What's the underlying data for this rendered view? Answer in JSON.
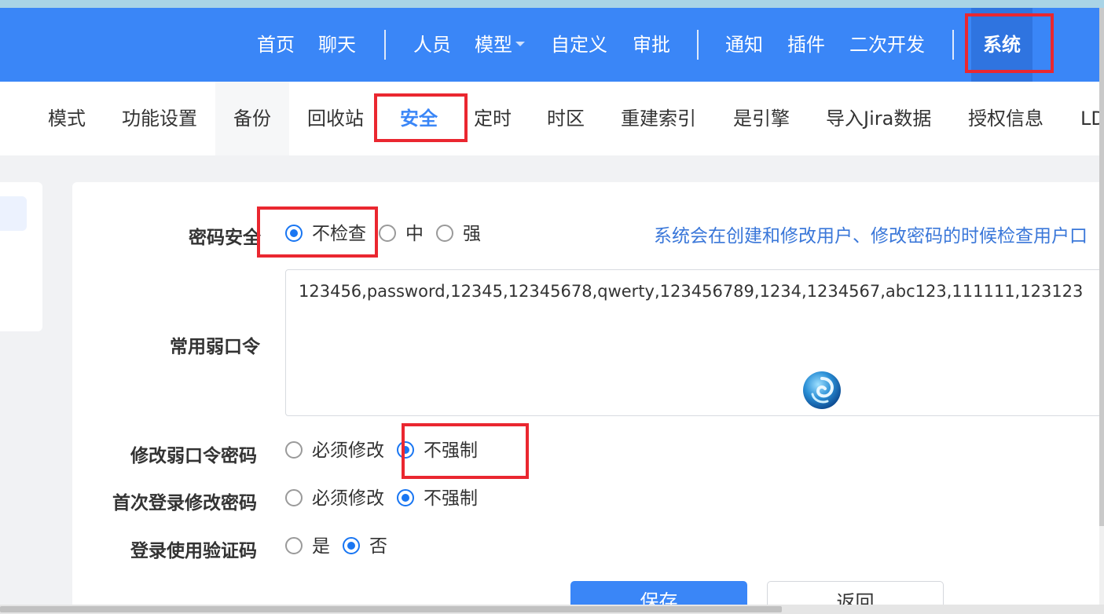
{
  "top_nav": {
    "items": [
      "首页",
      "聊天",
      "人员",
      "模型",
      "自定义",
      "审批",
      "通知",
      "插件",
      "二次开发",
      "系统"
    ],
    "active": "系统"
  },
  "sub_nav": {
    "tabs": [
      "模式",
      "功能设置",
      "备份",
      "回收站",
      "安全",
      "定时",
      "时区",
      "重建索引",
      "是引擎",
      "导入Jira数据",
      "授权信息",
      "LD"
    ],
    "active": "安全"
  },
  "form": {
    "password_security": {
      "label": "密码安全",
      "options": [
        "不检查",
        "中",
        "强"
      ],
      "selected": "不检查",
      "hint": "系统会在创建和修改用户、修改密码的时候检查用户口"
    },
    "weak_passwords": {
      "label": "常用弱口令",
      "value": "123456,password,12345,12345678,qwerty,123456789,1234,1234567,abc123,111111,123123"
    },
    "change_weak_password": {
      "label": "修改弱口令密码",
      "options": [
        "必须修改",
        "不强制"
      ],
      "selected": "不强制"
    },
    "first_login_change": {
      "label": "首次登录修改密码",
      "options": [
        "必须修改",
        "不强制"
      ],
      "selected": "不强制"
    },
    "login_captcha": {
      "label": "登录使用验证码",
      "options": [
        "是",
        "否"
      ],
      "selected": "否"
    }
  },
  "buttons": {
    "save": "保存",
    "back": "返回"
  },
  "colors": {
    "nav_bg": "#3a86f7",
    "accent": "#1976f2",
    "highlight_box": "#ea2730",
    "hint_text": "#3a77d9"
  },
  "icons": {
    "floating": "swirl-logo-icon"
  }
}
